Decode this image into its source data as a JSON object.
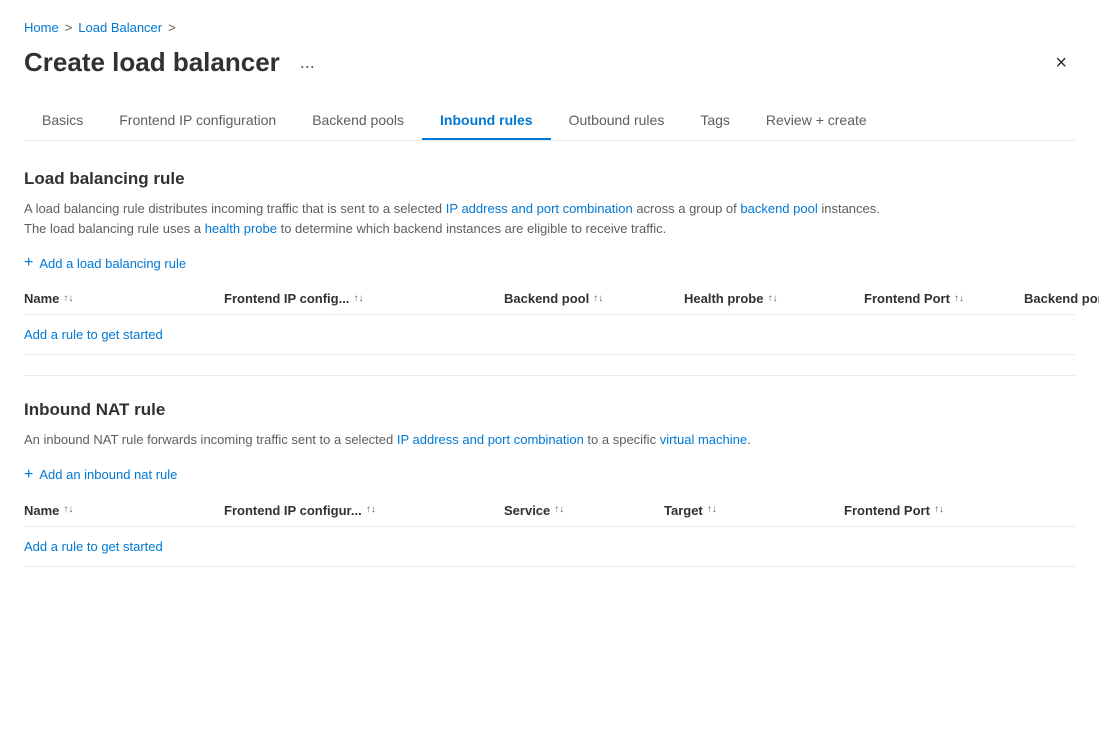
{
  "breadcrumb": {
    "home": "Home",
    "separator1": ">",
    "loadBalancer": "Load Balancer",
    "separator2": ">"
  },
  "page": {
    "title": "Create load balancer",
    "ellipsis": "...",
    "close": "×"
  },
  "tabs": [
    {
      "id": "basics",
      "label": "Basics",
      "active": false
    },
    {
      "id": "frontend-ip",
      "label": "Frontend IP configuration",
      "active": false
    },
    {
      "id": "backend-pools",
      "label": "Backend pools",
      "active": false
    },
    {
      "id": "inbound-rules",
      "label": "Inbound rules",
      "active": true
    },
    {
      "id": "outbound-rules",
      "label": "Outbound rules",
      "active": false
    },
    {
      "id": "tags",
      "label": "Tags",
      "active": false
    },
    {
      "id": "review-create",
      "label": "Review + create",
      "active": false
    }
  ],
  "loadBalancingRule": {
    "title": "Load balancing rule",
    "description_part1": "A load balancing rule distributes incoming traffic that is sent to a selected ",
    "description_ip": "IP address and port combination",
    "description_part2": " across a group of ",
    "description_backend": "backend pool",
    "description_part3": " instances.",
    "description2_part1": "The load balancing rule uses a ",
    "description2_health": "health probe",
    "description2_part2": " to determine which backend instances are eligible to receive traffic.",
    "addLink": "Add a load balancing rule",
    "emptyRow": "Add a rule to get started",
    "columns": [
      {
        "label": "Name",
        "id": "name"
      },
      {
        "label": "Frontend IP config...",
        "id": "frontend-ip-config"
      },
      {
        "label": "Backend pool",
        "id": "backend-pool"
      },
      {
        "label": "Health probe",
        "id": "health-probe"
      },
      {
        "label": "Frontend Port",
        "id": "frontend-port"
      },
      {
        "label": "Backend port",
        "id": "backend-port"
      }
    ]
  },
  "inboundNatRule": {
    "title": "Inbound NAT rule",
    "description_part1": "An inbound NAT rule forwards incoming traffic sent to a selected ",
    "description_ip": "IP address and port combination",
    "description_part2": " to a specific ",
    "description_vm": "virtual machine",
    "description_part3": ".",
    "addLink": "Add an inbound nat rule",
    "emptyRow": "Add a rule to get started",
    "columns": [
      {
        "label": "Name",
        "id": "name"
      },
      {
        "label": "Frontend IP configur...",
        "id": "frontend-ip-config"
      },
      {
        "label": "Service",
        "id": "service"
      },
      {
        "label": "Target",
        "id": "target"
      },
      {
        "label": "Frontend Port",
        "id": "frontend-port"
      }
    ]
  },
  "icons": {
    "sort": "↑↓",
    "plus": "+",
    "close": "×",
    "ellipsis": "···"
  }
}
